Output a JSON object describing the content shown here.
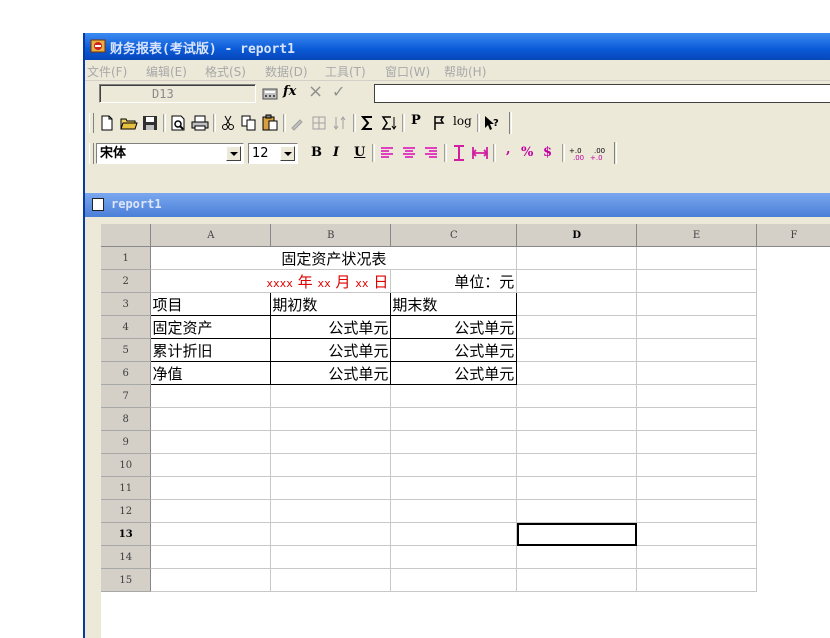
{
  "window": {
    "title": "财务报表(考试版) - report1"
  },
  "menubar": {
    "items": [
      "文件(F)",
      "编辑(E)",
      "格式(S)",
      "数据(D)",
      "工具(T)",
      "窗口(W)",
      "帮助(H)"
    ]
  },
  "formula_bar": {
    "cell_ref": "D13",
    "fx": "fx",
    "cancel": "×",
    "confirm": "✓",
    "value": ""
  },
  "toolbar_format": {
    "font_name": "宋体",
    "font_size": "12",
    "bold": "B",
    "italic": "I",
    "underline": "U",
    "comma": ",",
    "percent": "%",
    "currency": "$",
    "log": "log"
  },
  "sheet_window": {
    "title": "report1"
  },
  "sheet": {
    "columns": [
      "A",
      "B",
      "C",
      "D",
      "E",
      "F"
    ],
    "rows": [
      "1",
      "2",
      "3",
      "4",
      "5",
      "6",
      "7",
      "8",
      "9",
      "10",
      "11",
      "12",
      "13",
      "14",
      "15"
    ],
    "selected_cell": "D13",
    "title": "固定资产状况表",
    "date_line": {
      "year": "xxxx",
      "year_label": "年",
      "month": "xx",
      "month_label": "月",
      "day": "xx",
      "day_label": "日"
    },
    "unit": "单位：元",
    "table": {
      "headers": [
        "项目",
        "期初数",
        "期末数"
      ],
      "rows": [
        [
          "固定资产",
          "公式单元",
          "公式单元"
        ],
        [
          "累计折旧",
          "公式单元",
          "公式单元"
        ],
        [
          "净值",
          "公式单元",
          "公式单元"
        ]
      ]
    }
  },
  "colors": {
    "title_bar": "#0a5ad8",
    "menu_disabled_text": "#a8a8a8",
    "red_text": "#e00000"
  }
}
